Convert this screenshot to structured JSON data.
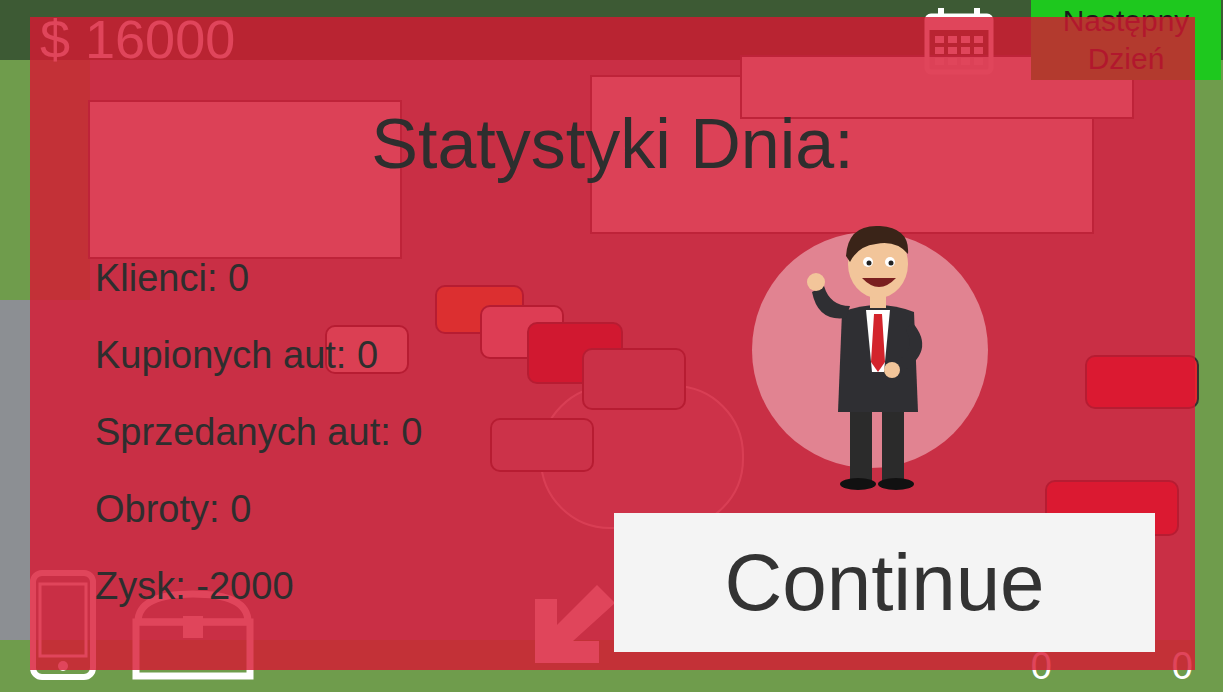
{
  "hud": {
    "money": "$ 16000",
    "next_day_button": "Następny Dzień",
    "counters": [
      "0",
      "0"
    ]
  },
  "dialog": {
    "title": "Statystyki Dnia:",
    "stats": [
      "Klienci: 0",
      "Kupionych aut: 0",
      "Sprzedanych aut: 0",
      "Obroty: 0",
      "Zysk: -2000"
    ],
    "continue_button": "Continue"
  }
}
